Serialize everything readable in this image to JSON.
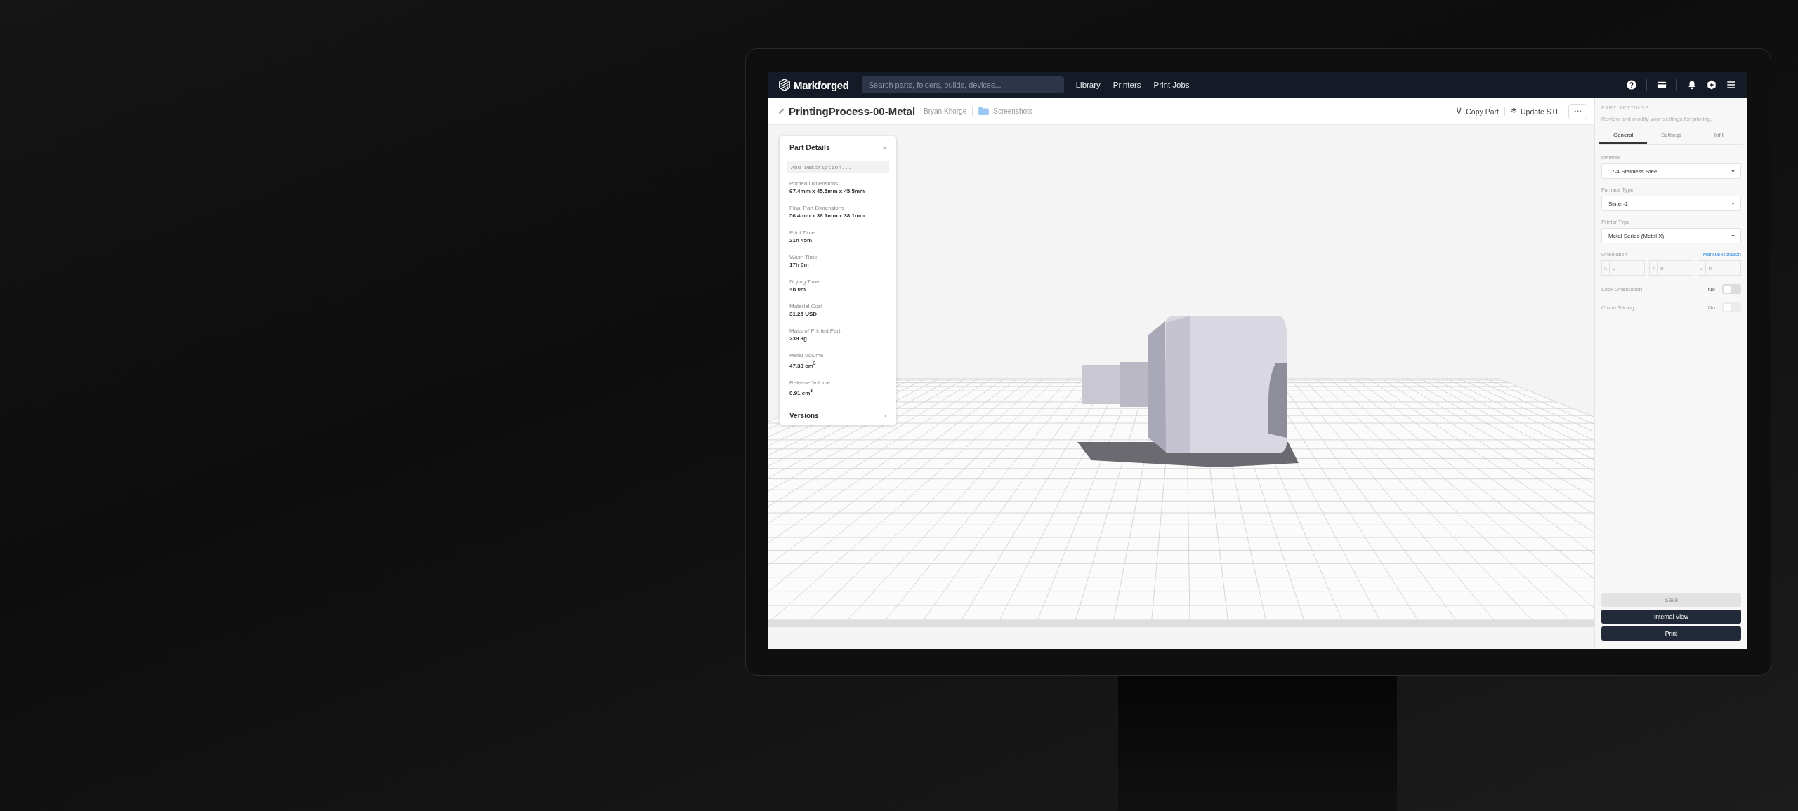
{
  "nav": {
    "logo": "Markforged",
    "search_placeholder": "Search parts, folders, builds, devices...",
    "links": [
      {
        "label": "Library"
      },
      {
        "label": "Printers"
      },
      {
        "label": "Print Jobs"
      }
    ]
  },
  "header": {
    "title": "PrintingProcess-00-Metal",
    "owner": "Bryan Khorge",
    "folder": "Screenshots",
    "actions": [
      {
        "label": "Copy Part",
        "kind": "copy"
      },
      {
        "label": "Update STL",
        "kind": "update"
      }
    ]
  },
  "part_details": {
    "title": "Part Details",
    "expanded": true,
    "description_placeholder": "Add Description...",
    "fields": [
      {
        "label": "Printed Dimensions",
        "value": "67.4mm x 45.5mm x 45.5mm"
      },
      {
        "label": "Final Part Dimensions",
        "value": "56.4mm x 38.1mm x 38.1mm"
      },
      {
        "label": "Print Time",
        "value": "21h 45m"
      },
      {
        "label": "Wash Time",
        "value": "17h 0m"
      },
      {
        "label": "Drying Time",
        "value": "4h 0m"
      },
      {
        "label": "Material Cost",
        "value": "31.25 USD"
      },
      {
        "label": "Mass of Printed Part",
        "value": "239.8g"
      },
      {
        "label": "Metal Volume",
        "value": "47.38 cm$^{3}$"
      },
      {
        "label": "Release Volume",
        "value": "0.91 cm$^{3}$"
      }
    ],
    "versions": "Versions"
  },
  "part_settings": {
    "heading": "PART SETTINGS",
    "subtitle": "Review and modify your settings for printing.",
    "tabs": [
      {
        "label": "General",
        "selected": true
      },
      {
        "label": "Settings",
        "selected": false
      },
      {
        "label": "Infill",
        "selected": false
      }
    ],
    "selects": [
      {
        "label": "Material",
        "value": "17-4 Stainless Steel"
      },
      {
        "label": "Furnace Type",
        "value": "Sinter-1"
      },
      {
        "label": "Printer Type",
        "value": "Metal Series (Metal X)"
      }
    ],
    "orientation": {
      "label": "Orientation",
      "link": "Manual Rotation",
      "axes": [
        {
          "axis": "X",
          "placeholder": "0"
        },
        {
          "axis": "Y",
          "placeholder": "0"
        },
        {
          "axis": "Z",
          "placeholder": "0"
        }
      ]
    },
    "toggles": [
      {
        "label": "Lock Orientation",
        "state": "No",
        "on": false,
        "disabled": false
      },
      {
        "label": "Cloud Slicing",
        "state": "No",
        "on": false,
        "disabled": true
      }
    ],
    "buttons": [
      {
        "label": "Save",
        "kind": "disabled"
      },
      {
        "label": "Internal View",
        "kind": "primary"
      },
      {
        "label": "Print",
        "kind": "primary"
      }
    ]
  }
}
